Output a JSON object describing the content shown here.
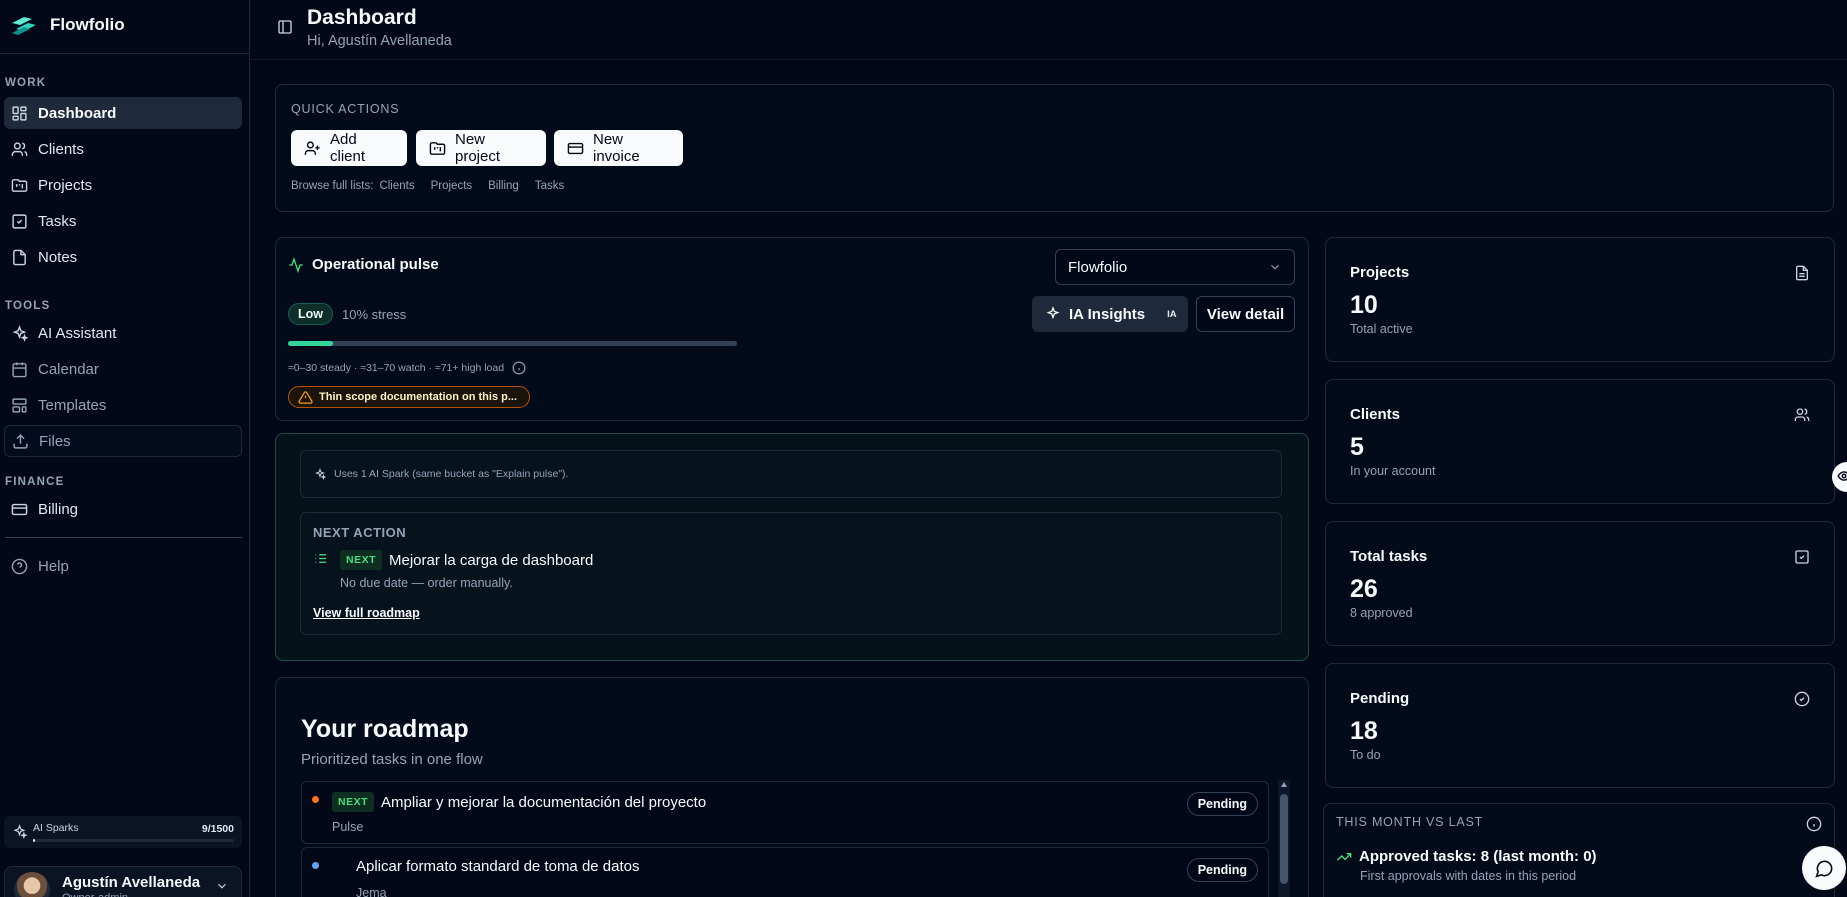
{
  "app": {
    "name": "Flowfolio"
  },
  "sidebar": {
    "sections": {
      "work": "WORK",
      "tools": "TOOLS",
      "finance": "FINANCE"
    },
    "work_items": [
      {
        "label": "Dashboard",
        "icon": "layout-grid-icon",
        "active": true
      },
      {
        "label": "Clients",
        "icon": "users-icon"
      },
      {
        "label": "Projects",
        "icon": "folder-kanban-icon"
      },
      {
        "label": "Tasks",
        "icon": "square-check-icon"
      },
      {
        "label": "Notes",
        "icon": "file-icon"
      }
    ],
    "tool_items": [
      {
        "label": "AI Assistant",
        "icon": "sparkles-icon"
      },
      {
        "label": "Calendar",
        "icon": "calendar-icon",
        "muted": true
      },
      {
        "label": "Templates",
        "icon": "layout-template-icon",
        "muted": true
      },
      {
        "label": "Files",
        "icon": "upload-icon",
        "muted": true
      }
    ],
    "finance_items": [
      {
        "label": "Billing",
        "icon": "credit-card-icon"
      }
    ],
    "help": {
      "label": "Help",
      "icon": "help-circle-icon"
    },
    "sparks": {
      "label": "AI Sparks",
      "count": "9/1500",
      "used_fraction": 0.006
    },
    "user": {
      "name": "Agustín Avellaneda",
      "role": "Owner·admin"
    }
  },
  "header": {
    "title": "Dashboard",
    "subtitle": "Hi, Agustín Avellaneda"
  },
  "quick_actions": {
    "label": "QUICK ACTIONS",
    "buttons": [
      {
        "label": "Add client",
        "icon": "user-plus-icon"
      },
      {
        "label": "New project",
        "icon": "folder-plus-icon"
      },
      {
        "label": "New invoice",
        "icon": "credit-card-icon"
      }
    ],
    "browse_label": "Browse full lists:",
    "browse_links": [
      "Clients",
      "Projects",
      "Billing",
      "Tasks"
    ]
  },
  "pulse": {
    "title": "Operational pulse",
    "select_value": "Flowfolio",
    "level": "Low",
    "stress_text": "10% stress",
    "stress_fraction": 0.1,
    "scale_text": "≈0–30 steady · ≈31–70 watch · ≈71+ high load",
    "warning": "Thin scope documentation on this p...",
    "insights_label": "IA Insights",
    "insights_badge": "IA",
    "view_detail": "View detail"
  },
  "ai_action": {
    "note": "Uses 1 AI Spark (same bucket as \"Explain pulse\").",
    "next_label": "NEXT ACTION",
    "tag": "NEXT",
    "task": "Mejorar la carga de dashboard",
    "due": "No due date — order manually.",
    "link": "View full roadmap"
  },
  "roadmap": {
    "title": "Your roadmap",
    "subtitle": "Prioritized tasks in one flow",
    "items": [
      {
        "tag": "NEXT",
        "title": "Ampliar y mejorar la documentación del proyecto",
        "meta": "Pulse",
        "status": "Pending",
        "dot": "#f97316"
      },
      {
        "tag": "",
        "title": "Aplicar formato standard de toma de datos",
        "meta": "Jema",
        "status": "Pending",
        "dot": "#60a5fa"
      }
    ]
  },
  "stats": [
    {
      "title": "Projects",
      "value": "10",
      "sub": "Total active",
      "icon": "file-text-icon"
    },
    {
      "title": "Clients",
      "value": "5",
      "sub": "In your account",
      "icon": "users-icon"
    },
    {
      "title": "Total tasks",
      "value": "26",
      "sub": "8 approved",
      "icon": "square-check-icon"
    },
    {
      "title": "Pending",
      "value": "18",
      "sub": "To do",
      "icon": "circle-check-icon"
    }
  ],
  "month": {
    "label": "THIS MONTH VS LAST",
    "headline": "Approved tasks: 8 (last month: 0)",
    "sub": "First approvals with dates in this period"
  },
  "colors": {
    "background": "#020817",
    "accent_green": "#34d399",
    "warning": "#f59e0b"
  }
}
